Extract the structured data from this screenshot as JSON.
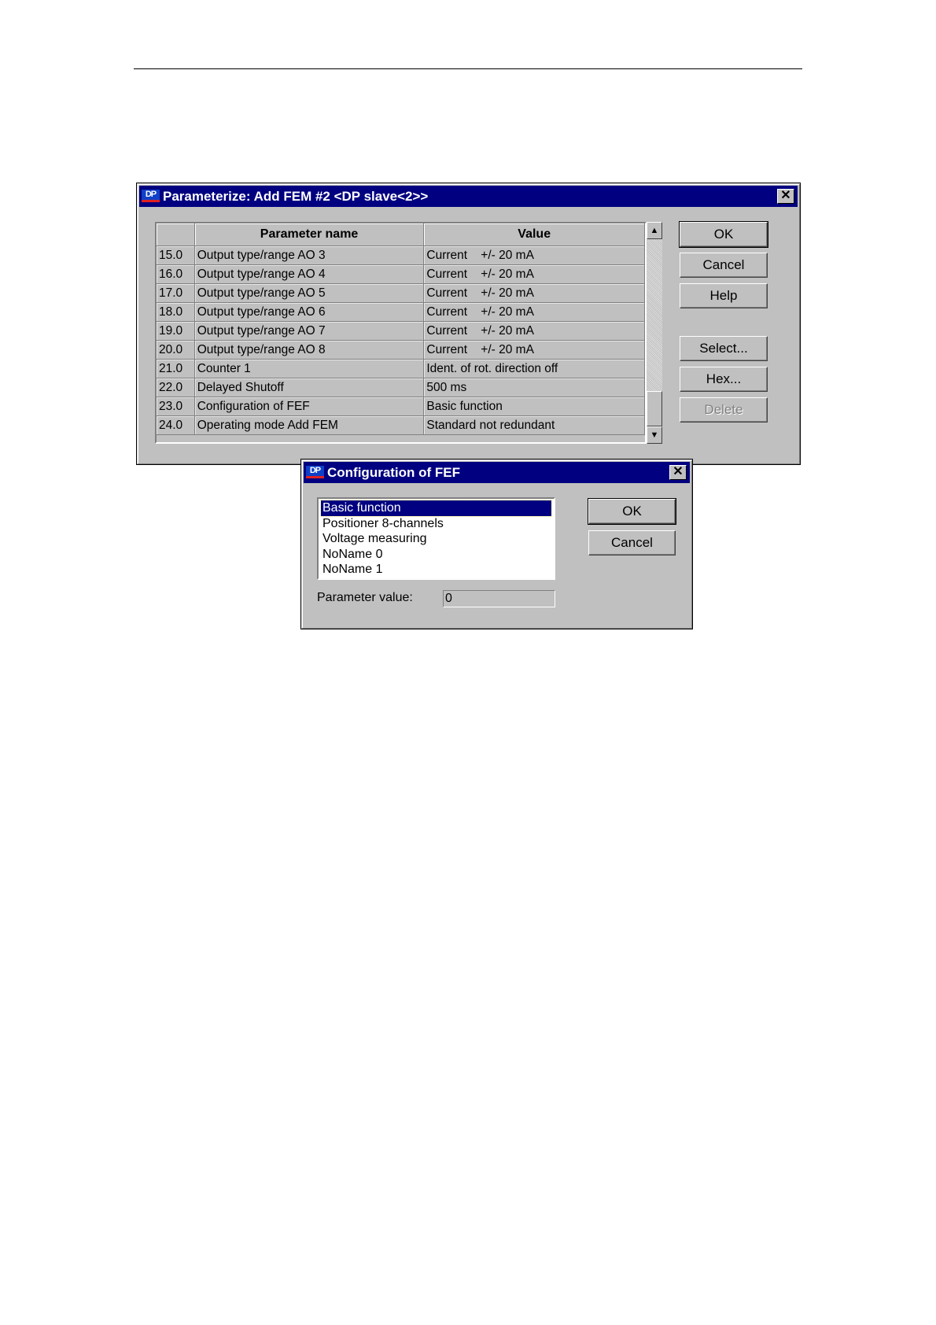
{
  "main_dialog": {
    "title": "Parameterize: Add FEM  #2  <DP slave<2>>",
    "icon_label": "DP",
    "columns": {
      "no": "",
      "name": "Parameter name",
      "value": "Value"
    },
    "rows": [
      {
        "no": "15.0",
        "name": "Output type/range AO 3",
        "value": "Current    +/- 20 mA"
      },
      {
        "no": "16.0",
        "name": "Output type/range AO 4",
        "value": "Current    +/- 20 mA"
      },
      {
        "no": "17.0",
        "name": "Output type/range AO 5",
        "value": "Current    +/- 20 mA"
      },
      {
        "no": "18.0",
        "name": "Output type/range AO 6",
        "value": "Current    +/- 20 mA"
      },
      {
        "no": "19.0",
        "name": "Output type/range AO 7",
        "value": "Current    +/- 20 mA"
      },
      {
        "no": "20.0",
        "name": "Output type/range AO 8",
        "value": "Current    +/- 20 mA"
      },
      {
        "no": "21.0",
        "name": "Counter 1",
        "value": "Ident. of rot. direction off"
      },
      {
        "no": "22.0",
        "name": "Delayed Shutoff",
        "value": "500 ms"
      },
      {
        "no": "23.0",
        "name": "Configuration of FEF",
        "value": "Basic function"
      },
      {
        "no": "24.0",
        "name": "Operating mode Add FEM",
        "value": "Standard not redundant"
      }
    ],
    "buttons": {
      "ok": "OK",
      "cancel": "Cancel",
      "help": "Help",
      "select": "Select...",
      "hex": "Hex...",
      "delete": "Delete"
    }
  },
  "fef_dialog": {
    "title": "Configuration of FEF",
    "icon_label": "DP",
    "options": [
      "Basic function",
      "Positioner 8-channels",
      "Voltage measuring",
      "NoName 0",
      "NoName 1"
    ],
    "selected": "Basic function",
    "param_label": "Parameter value:",
    "param_value": "0",
    "buttons": {
      "ok": "OK",
      "cancel": "Cancel"
    }
  },
  "colors": {
    "titlebar": "#000080",
    "face": "#c0c0c0",
    "selection": "#000080"
  },
  "icons": {
    "close": "close-icon",
    "scroll_up": "arrow-up-icon",
    "scroll_down": "arrow-down-icon",
    "app": "dp-icon"
  }
}
